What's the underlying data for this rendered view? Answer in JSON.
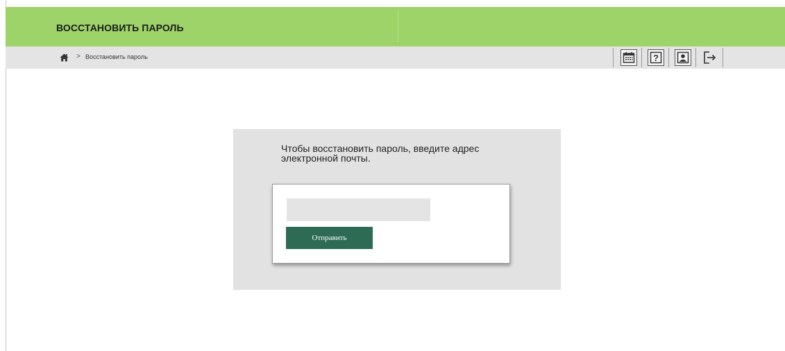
{
  "header": {
    "title": "ВОССТАНОВИТЬ ПАРОЛЬ",
    "accent_color": "#9ed36a"
  },
  "breadcrumb": {
    "home_icon": "home-icon",
    "separator": ">",
    "current": "Восстановить пароль"
  },
  "toolbar": {
    "items": [
      {
        "name": "calendar-icon"
      },
      {
        "name": "help-icon",
        "glyph": "?"
      },
      {
        "name": "user-card-icon"
      },
      {
        "name": "logout-icon"
      }
    ]
  },
  "form": {
    "instruction": "Чтобы восстановить пароль, введите адрес электронной почты.",
    "email_value": "",
    "email_placeholder": "",
    "submit_label": "Отправить",
    "button_color": "#2e6b55"
  }
}
